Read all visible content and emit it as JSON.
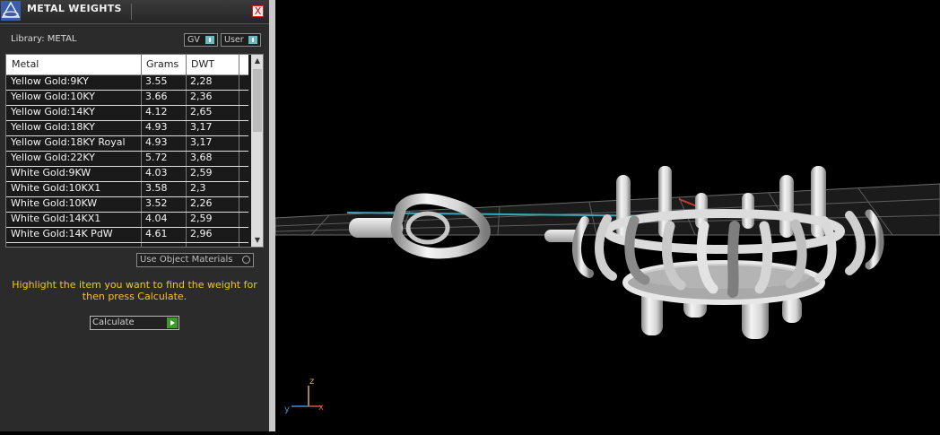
{
  "panel": {
    "title": "METAL WEIGHTS",
    "close": "X",
    "library_label": "Library: METAL",
    "toggles": [
      "GV",
      "User"
    ],
    "table": {
      "headers": [
        "Metal",
        "Grams",
        "DWT"
      ],
      "rows": [
        [
          "Yellow Gold:9KY",
          "3.55",
          "2,28"
        ],
        [
          "Yellow Gold:10KY",
          "3.66",
          "2,36"
        ],
        [
          "Yellow Gold:14KY",
          "4.12",
          "2,65"
        ],
        [
          "Yellow Gold:18KY",
          "4.93",
          "3,17"
        ],
        [
          "Yellow Gold:18KY Royal",
          "4.93",
          "3,17"
        ],
        [
          "Yellow Gold:22KY",
          "5.72",
          "3,68"
        ],
        [
          "White Gold:9KW",
          "4.03",
          "2,59"
        ],
        [
          "White Gold:10KX1",
          "3.58",
          "2,3"
        ],
        [
          "White Gold:10KW",
          "3.52",
          "2,26"
        ],
        [
          "White Gold:14KX1",
          "4.04",
          "2,59"
        ],
        [
          "White Gold:14K PdW",
          "4.61",
          "2,96"
        ]
      ]
    },
    "use_object_materials": "Use Object Materials",
    "hint": "Highlight the item you want to find the weight for then press Calculate.",
    "calculate": "Calculate"
  },
  "viewport": {
    "axes": {
      "z": "z",
      "y": "y",
      "x": "x"
    }
  }
}
